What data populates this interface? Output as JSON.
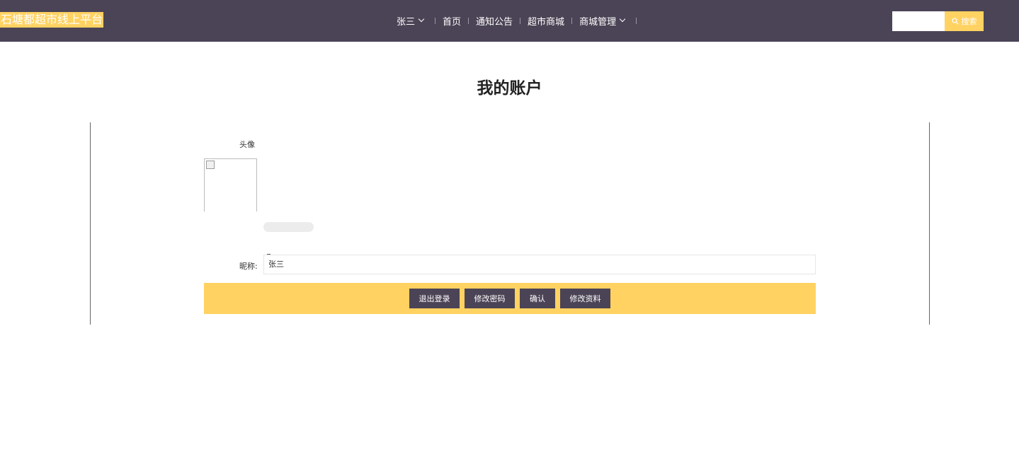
{
  "header": {
    "brand": "石塘都超市线上平台",
    "nav": [
      {
        "label": "张三"
      },
      {
        "label": "首页"
      },
      {
        "label": "通知公告"
      },
      {
        "label": "超市商城"
      },
      {
        "label": "商城管理"
      }
    ],
    "search": {
      "placeholder": "",
      "button_label": "搜索"
    }
  },
  "page": {
    "title": "我的账户"
  },
  "form": {
    "avatar_label": "头像",
    "nickname_label": "昵称:",
    "nickname_value": "张三"
  },
  "actions": {
    "logout": "退出登录",
    "change_password": "修改密码",
    "confirm": "确认",
    "edit_profile": "修改资料"
  },
  "colors": {
    "header_bg": "#4b4456",
    "accent": "#ffd262"
  }
}
